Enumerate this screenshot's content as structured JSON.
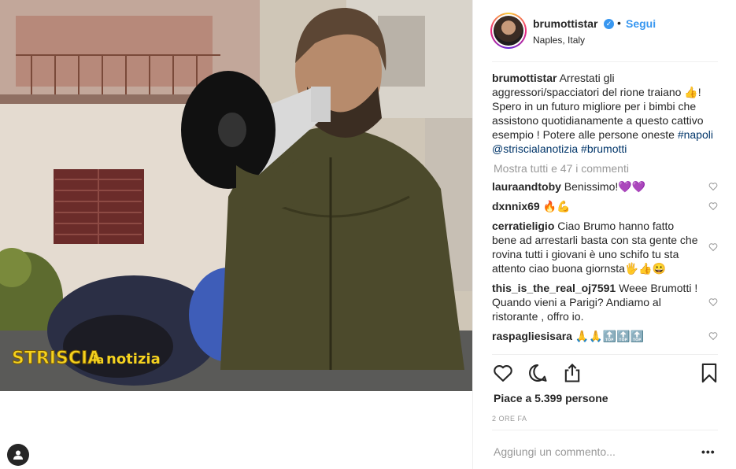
{
  "post": {
    "username": "brumottistar",
    "verified_mark": "✓",
    "dot": "•",
    "follow_label": "Segui",
    "location": "Naples, Italy",
    "photo_watermark": "STRISCIA la notizia"
  },
  "caption": {
    "username": "brumottistar",
    "text": "Arrestati gli aggressori/spacciatori del rione traiano 👍! Spero in un futuro migliore per i bimbi che assistono quotidianamente a questo cattivo esempio ! Potere alle persone oneste",
    "tags": [
      "#napoli",
      "@striscialanotizia",
      "#brumotti"
    ]
  },
  "view_all_comments": "Mostra tutti e 47 i commenti",
  "comments": [
    {
      "user": "lauraandtoby",
      "text": "Benissimo!💜💜"
    },
    {
      "user": "dxnnix69",
      "text": "🔥💪"
    },
    {
      "user": "cerratieligio",
      "text": "Ciao Brumo hanno fatto bene ad arrestarli basta con sta gente che rovina tutti i giovani è uno schifo tu sta attento ciao buona giornsta🖐👍😀"
    },
    {
      "user": "this_is_the_real_oj7591",
      "text": "Weee Brumotti ! Quando vieni a Parigi? Andiamo al ristorante , offro io."
    },
    {
      "user": "raspagliesisara",
      "text": "🙏🙏🔝🔝🔝"
    }
  ],
  "likes": "Piace a 5.399 persone",
  "timestamp": "2 ORE FA",
  "add_comment_placeholder": "Aggiungi un commento...",
  "options_label": "•••",
  "icons": {
    "like": "heart-icon",
    "comment": "comment-icon",
    "share": "share-icon",
    "save": "bookmark-icon",
    "tag": "user-tag-icon"
  }
}
